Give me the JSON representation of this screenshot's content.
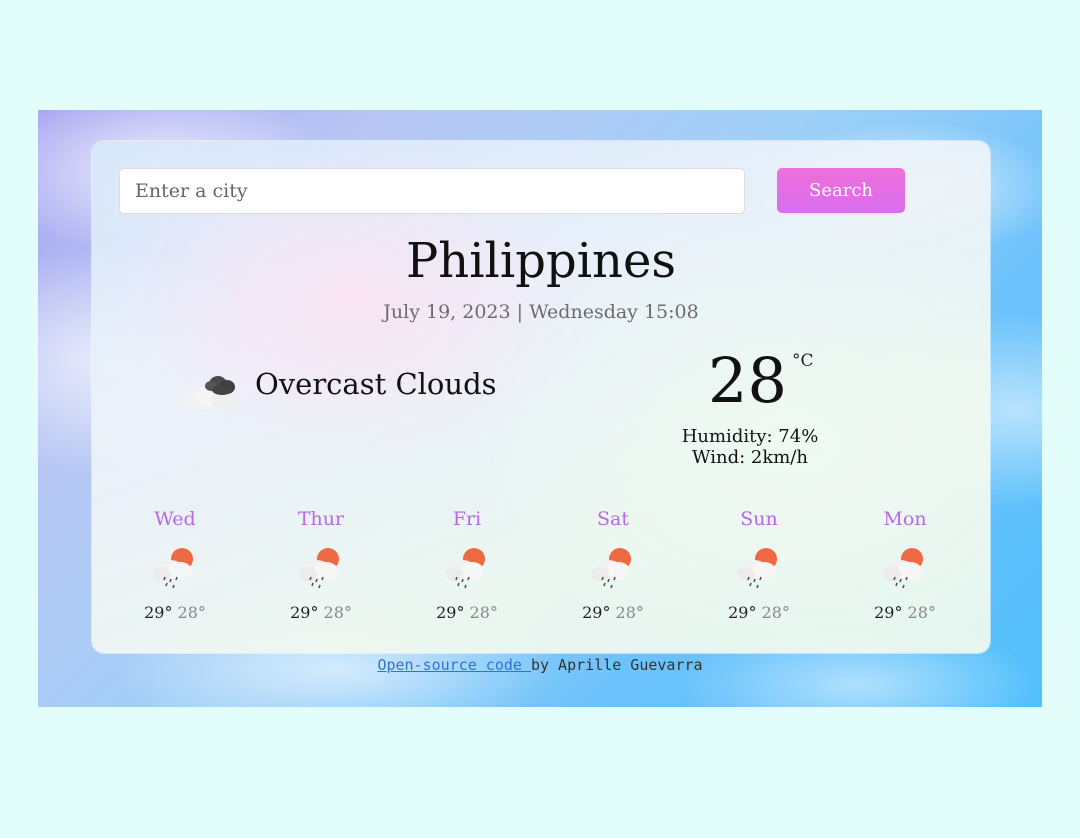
{
  "search": {
    "placeholder": "Enter a city",
    "button_label": "Search"
  },
  "current": {
    "city": "Philippines",
    "datetime": "July 19, 2023 | Wednesday 15:08",
    "condition": "Overcast Clouds",
    "condition_icon": "overcast-clouds-icon",
    "temperature": "28",
    "unit": "°C",
    "humidity": "Humidity: 74%",
    "wind": "Wind: 2km/h"
  },
  "forecast": [
    {
      "day": "Wed",
      "high": "29°",
      "low": "28°",
      "icon": "rain-sun-icon"
    },
    {
      "day": "Thur",
      "high": "29°",
      "low": "28°",
      "icon": "rain-sun-icon"
    },
    {
      "day": "Fri",
      "high": "29°",
      "low": "28°",
      "icon": "rain-sun-icon"
    },
    {
      "day": "Sat",
      "high": "29°",
      "low": "28°",
      "icon": "rain-sun-icon"
    },
    {
      "day": "Sun",
      "high": "29°",
      "low": "28°",
      "icon": "rain-sun-icon"
    },
    {
      "day": "Mon",
      "high": "29°",
      "low": "28°",
      "icon": "rain-sun-icon"
    }
  ],
  "footer": {
    "link_text": "Open-source code ",
    "suffix": "by Aprille Guevarra"
  },
  "colors": {
    "page_background": "#e3fdfa",
    "search_button": "#e56fe3",
    "day_label": "#b768e6",
    "sun": "#ee6a43",
    "link": "#2e73d6"
  }
}
